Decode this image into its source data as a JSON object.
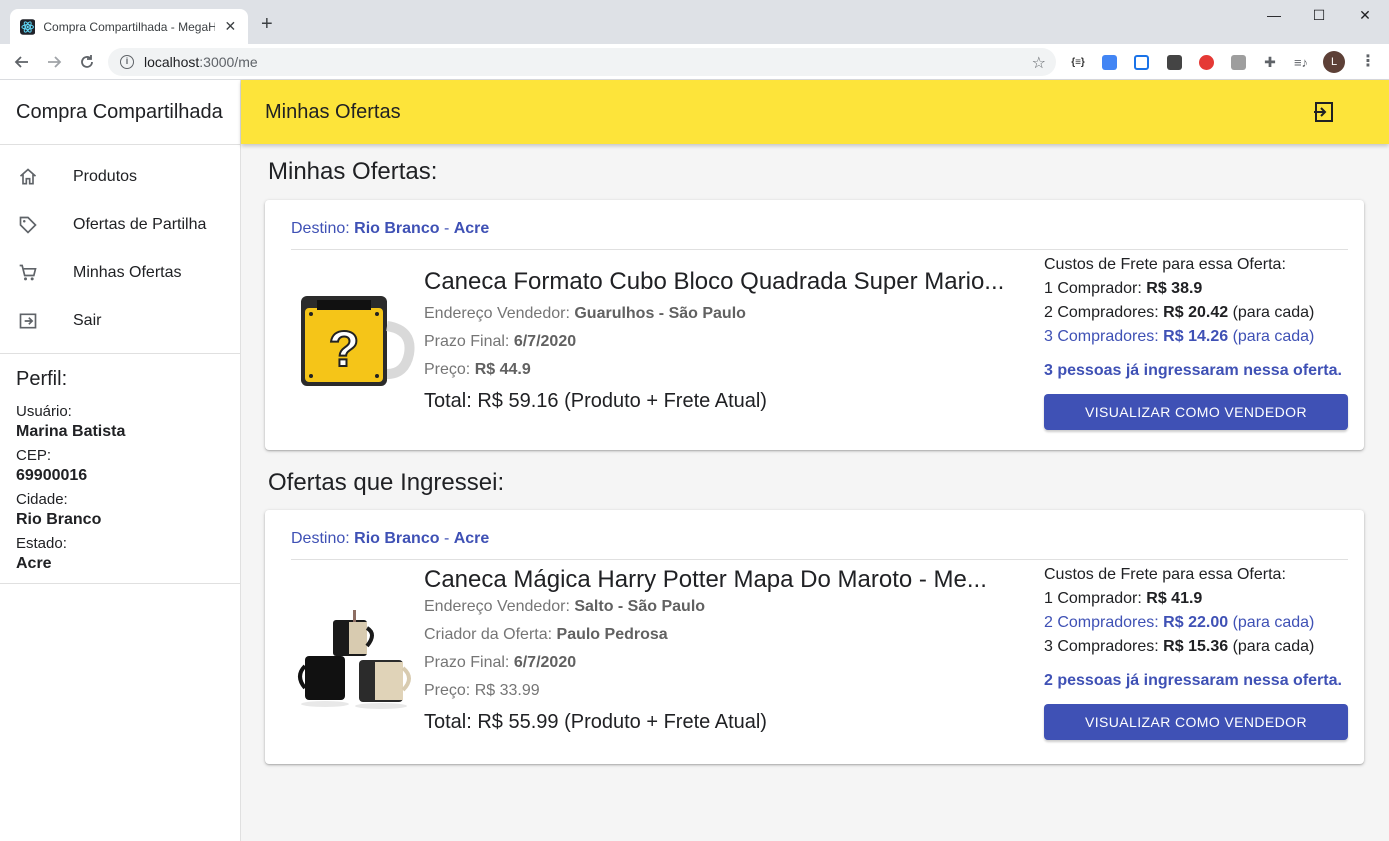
{
  "browser": {
    "tab_title": "Compra Compartilhada - MegaH",
    "url_host": "localhost",
    "url_path": ":3000/me",
    "profile_initial": "L",
    "extensions": [
      "json-icon",
      "translate-icon",
      "screenshot-icon",
      "download-icon",
      "adblock-icon",
      "cast-icon",
      "puzzle-icon",
      "media-icon"
    ]
  },
  "app": {
    "brand": "Compra Compartilhada",
    "header_title": "Minhas Ofertas"
  },
  "sidebar": {
    "items": [
      {
        "label": "Produtos",
        "icon": "home-icon"
      },
      {
        "label": "Ofertas de Partilha",
        "icon": "tag-icon"
      },
      {
        "label": "Minhas Ofertas",
        "icon": "cart-icon"
      },
      {
        "label": "Sair",
        "icon": "logout-icon"
      }
    ],
    "profile": {
      "title": "Perfil:",
      "user_label": "Usuário:",
      "user": "Marina Batista",
      "cep_label": "CEP:",
      "cep": "69900016",
      "city_label": "Cidade:",
      "city": "Rio Branco",
      "state_label": "Estado:",
      "state": "Acre"
    }
  },
  "sections": {
    "my_offers": "Minhas Ofertas:",
    "joined_offers": "Ofertas que Ingressei:"
  },
  "offers": [
    {
      "dest_label": "Destino:",
      "dest_city": "Rio Branco",
      "dest_sep": " - ",
      "dest_state": "Acre",
      "name": "Caneca Formato Cubo Bloco Quadrada Super Mario...",
      "seller_label": "Endereço Vendedor:",
      "seller": "Guarulhos - São Paulo",
      "deadline_label": "Prazo Final:",
      "deadline": "6/7/2020",
      "price_label": "Preço:",
      "price": "R$ 44.9",
      "total": "Total: R$ 59.16 (Produto + Frete Atual)",
      "freight_title": "Custos de Frete para essa Oferta:",
      "f1_label": "1 Comprador:",
      "f1_value": "R$ 38.9",
      "f2_label": "2 Compradores:",
      "f2_value": "R$ 20.42",
      "f2_each": "(para cada)",
      "f3_label": "3 Compradores:",
      "f3_value": "R$ 14.26",
      "f3_each": "(para cada)",
      "people": "3 pessoas já ingressaram nessa oferta.",
      "button": "VISUALIZAR COMO VENDEDOR"
    },
    {
      "dest_label": "Destino:",
      "dest_city": "Rio Branco",
      "dest_sep": " - ",
      "dest_state": "Acre",
      "name": "Caneca Mágica Harry Potter Mapa Do Maroto - Me...",
      "seller_label": "Endereço Vendedor:",
      "seller": "Salto - São Paulo",
      "creator_label": "Criador da Oferta:",
      "creator": "Paulo Pedrosa",
      "deadline_label": "Prazo Final:",
      "deadline": "6/7/2020",
      "price_label": "Preço:",
      "price": "R$ 33.99",
      "total": "Total: R$ 55.99 (Produto + Frete Atual)",
      "freight_title": "Custos de Frete para essa Oferta:",
      "f1_label": "1 Comprador:",
      "f1_value": "R$ 41.9",
      "f2_label": "2 Compradores:",
      "f2_value": "R$ 22.00",
      "f2_each": "(para cada)",
      "f3_label": "3 Compradores:",
      "f3_value": "R$ 15.36",
      "f3_each": "(para cada)",
      "people": "2 pessoas já ingressaram nessa oferta.",
      "button": "VISUALIZAR COMO VENDEDOR"
    }
  ],
  "colors": {
    "appbar": "#fde43a",
    "primary": "#3f51b5"
  }
}
